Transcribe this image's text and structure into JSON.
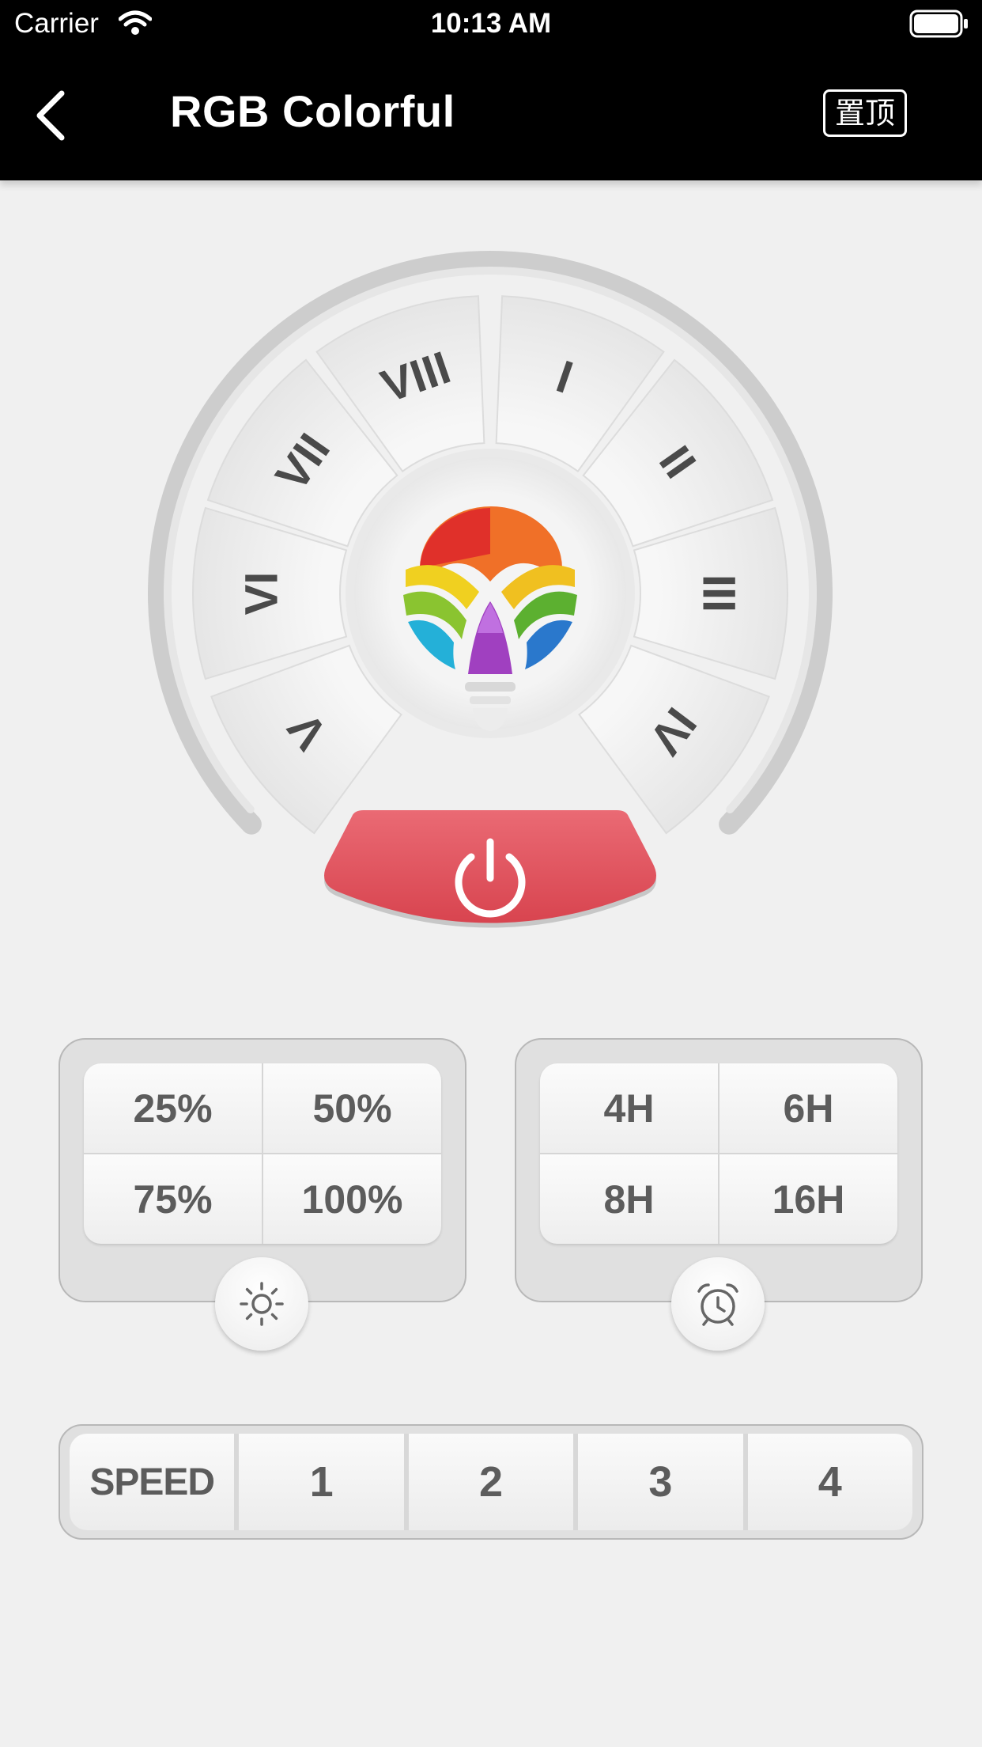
{
  "status_bar": {
    "carrier": "Carrier",
    "time": "10:13 AM"
  },
  "header": {
    "title": "RGB Colorful",
    "pin_label": "置顶"
  },
  "dial": {
    "modes": [
      "I",
      "II",
      "III",
      "IV",
      "V",
      "VI",
      "VII",
      "VIII"
    ]
  },
  "brightness": {
    "options": [
      "25%",
      "50%",
      "75%",
      "100%"
    ]
  },
  "timer": {
    "options": [
      "4H",
      "6H",
      "8H",
      "16H"
    ]
  },
  "speed": {
    "label": "SPEED",
    "options": [
      "1",
      "2",
      "3",
      "4"
    ]
  },
  "colors": {
    "power": "#e05a64",
    "nav_bg": "#000000",
    "page_bg": "#f0f0f0"
  }
}
